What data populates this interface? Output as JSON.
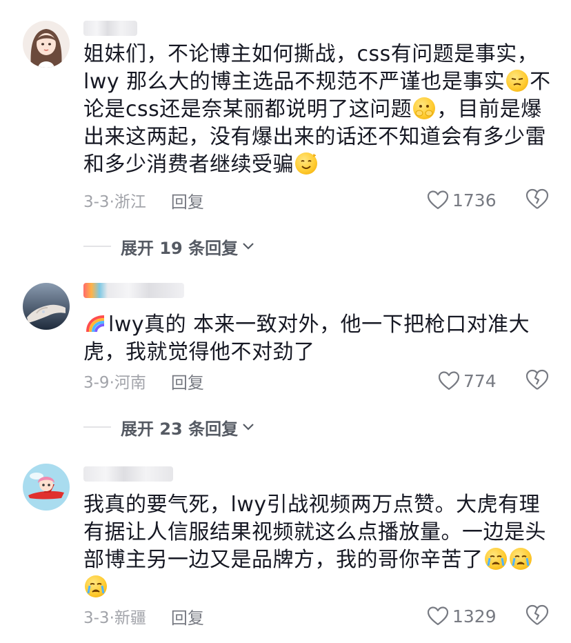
{
  "comments": [
    {
      "text_parts": [
        "姐妹们，不论博主如何撕战，css有问题是事实，lwy 那么大的博主选品不规范不严谨也是事实",
        "不论是css还是奈某丽都说明了这问题",
        "，目前是爆出来这两起，没有爆出来的话还不知道会有多少雷和多少消费者继续受骗",
        ""
      ],
      "date_location": "3-3·浙江",
      "reply_label": "回复",
      "likes": "1736",
      "expand_label": "展开 19 条回复"
    },
    {
      "text_parts": [
        "lwy真的 本来一致对外，他一下把枪口对准大虎，我就觉得他不对劲了"
      ],
      "date_location": "3-9·河南",
      "reply_label": "回复",
      "likes": "774",
      "expand_label": "展开 23 条回复"
    },
    {
      "text_parts": [
        "我真的要气死，lwy引战视频两万点赞。大虎有理有据让人信服结果视频就这么点播放量。一边是头部博主另一边又是品牌方，我的哥你辛苦了"
      ],
      "date_location": "3-3·新疆",
      "reply_label": "回复",
      "likes": "1329"
    }
  ],
  "icons": {
    "like": "heart-outline-icon",
    "dislike": "broken-heart-icon",
    "expand": "chevron-down-icon"
  },
  "colors": {
    "text": "#161823",
    "meta": "#a1a3a9",
    "action": "#777a82"
  }
}
